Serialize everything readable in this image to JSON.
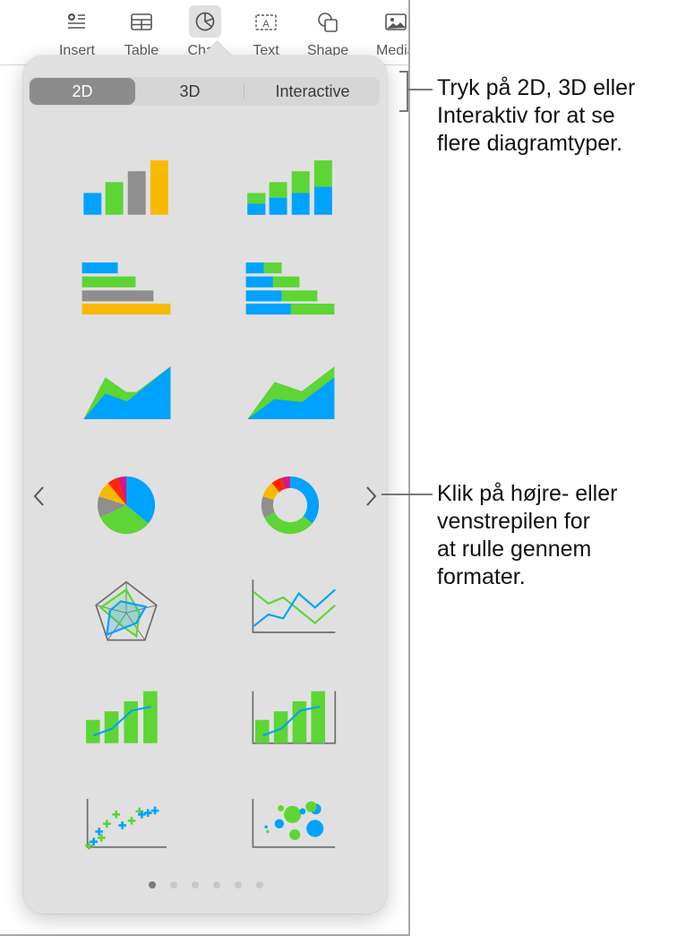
{
  "toolbar": {
    "items": [
      {
        "label": "Insert",
        "icon": "insert-list-icon"
      },
      {
        "label": "Table",
        "icon": "table-icon"
      },
      {
        "label": "Chart",
        "icon": "pie-chart-icon",
        "active": true
      },
      {
        "label": "Text",
        "icon": "text-box-icon"
      },
      {
        "label": "Shape",
        "icon": "shape-icon"
      },
      {
        "label": "Media",
        "icon": "media-icon"
      }
    ]
  },
  "chart_picker": {
    "tabs": [
      {
        "label": "2D",
        "selected": true
      },
      {
        "label": "3D",
        "selected": false
      },
      {
        "label": "Interactive",
        "selected": false
      }
    ],
    "colors": {
      "blue": "#00a2ff",
      "green": "#5dd535",
      "gray": "#8e8e8e",
      "yellow": "#f8ba00",
      "red": "#ff2600",
      "magenta": "#d41a7f",
      "axis": "#6e6e6e"
    },
    "charts": [
      {
        "name": "column-chart",
        "type": "column"
      },
      {
        "name": "stacked-column-chart",
        "type": "stacked-column"
      },
      {
        "name": "bar-chart",
        "type": "bar"
      },
      {
        "name": "stacked-bar-chart",
        "type": "stacked-bar"
      },
      {
        "name": "area-chart",
        "type": "area"
      },
      {
        "name": "stacked-area-chart",
        "type": "stacked-area"
      },
      {
        "name": "pie-chart",
        "type": "pie"
      },
      {
        "name": "donut-chart",
        "type": "donut"
      },
      {
        "name": "radar-chart",
        "type": "radar"
      },
      {
        "name": "line-chart",
        "type": "line"
      },
      {
        "name": "mixed-chart",
        "type": "mixed"
      },
      {
        "name": "two-axis-chart",
        "type": "two-axis"
      },
      {
        "name": "scatter-chart",
        "type": "scatter"
      },
      {
        "name": "bubble-chart",
        "type": "bubble"
      }
    ],
    "prev_icon": "chevron-left-icon",
    "next_icon": "chevron-right-icon",
    "pages": {
      "count": 6,
      "current": 1
    }
  },
  "callouts": {
    "top": [
      "Tryk på 2D, 3D eller",
      "Interaktiv for at se",
      "flere diagramtyper."
    ],
    "middle": [
      "Klik på højre- eller",
      "venstrepilen for",
      "at rulle gennem",
      "formater."
    ]
  }
}
